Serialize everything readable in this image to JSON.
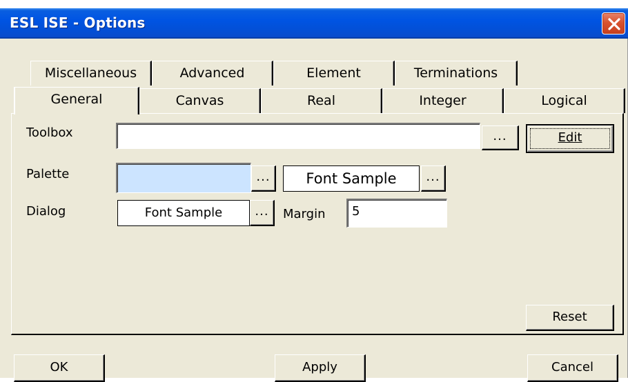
{
  "window": {
    "title": "ESL ISE - Options"
  },
  "tabs_back": [
    "Miscellaneous",
    "Advanced",
    "Element",
    "Terminations"
  ],
  "tabs_front": [
    "General",
    "Canvas",
    "Real",
    "Integer",
    "Logical"
  ],
  "active_tab": "General",
  "general": {
    "toolbox_label": "Toolbox",
    "toolbox_value": "",
    "ellipsis": "...",
    "edit_label": "Edit",
    "palette_label": "Palette",
    "palette_color": "#cce4ff",
    "palette_font_sample": "Font Sample",
    "dialog_label": "Dialog",
    "dialog_font_sample": "Font Sample",
    "margin_label": "Margin",
    "margin_value": "5",
    "reset_label": "Reset"
  },
  "footer": {
    "ok_label": "OK",
    "apply_label": "Apply",
    "cancel_label": "Cancel"
  },
  "colors": {
    "titlebar": "#0054e3",
    "dialog_bg": "#ece9d8",
    "close": "#d8532f"
  },
  "icons": {
    "close": "close-icon"
  }
}
